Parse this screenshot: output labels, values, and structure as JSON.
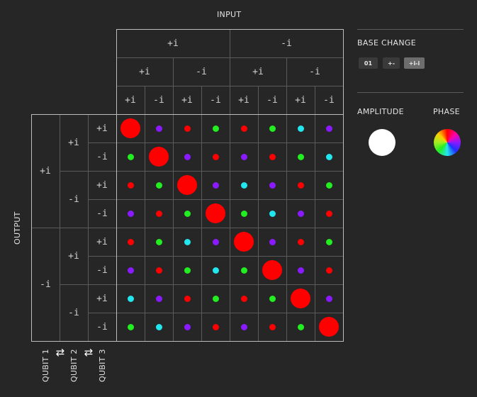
{
  "input_label": "INPUT",
  "output_label": "OUTPUT",
  "col_headers": {
    "q1": [
      "+i",
      "-i"
    ],
    "q2": [
      "+i",
      "-i",
      "+i",
      "-i"
    ],
    "q3": [
      "+i",
      "-i",
      "+i",
      "-i",
      "+i",
      "-i",
      "+i",
      "-i"
    ]
  },
  "row_headers": {
    "q1": [
      "+i",
      "-i"
    ],
    "q2": [
      "+i",
      "-i",
      "+i",
      "-i"
    ],
    "q3": [
      "+i",
      "-i",
      "+i",
      "-i",
      "+i",
      "-i",
      "+i",
      "-i"
    ]
  },
  "qubits": [
    "QUBIT 1",
    "QUBIT 2",
    "QUBIT 3"
  ],
  "swap_icon": "swap-arrows-icon",
  "base_change": {
    "title": "BASE CHANGE",
    "buttons": [
      {
        "label": "01",
        "active": false
      },
      {
        "label": "+-",
        "active": false
      },
      {
        "label": "+i-i",
        "active": true
      }
    ]
  },
  "amplitude": {
    "title": "AMPLITUDE"
  },
  "phase": {
    "title": "PHASE"
  },
  "colors": {
    "red": "#ff0000",
    "green": "#22ee22",
    "cyan": "#22e6ee",
    "purple": "#8a1aff",
    "background": "#262626",
    "grid": "#5a5a5a",
    "border": "#bdbdbd"
  },
  "matrix": [
    [
      "R",
      "P",
      "R",
      "G",
      "R",
      "G",
      "C",
      "P"
    ],
    [
      "G",
      "R",
      "P",
      "R",
      "P",
      "R",
      "G",
      "C"
    ],
    [
      "R",
      "G",
      "R",
      "P",
      "C",
      "P",
      "R",
      "G"
    ],
    [
      "P",
      "R",
      "G",
      "R",
      "G",
      "C",
      "P",
      "R"
    ],
    [
      "R",
      "G",
      "C",
      "P",
      "R",
      "P",
      "R",
      "G"
    ],
    [
      "P",
      "R",
      "G",
      "C",
      "G",
      "R",
      "P",
      "R"
    ],
    [
      "C",
      "P",
      "R",
      "G",
      "R",
      "G",
      "R",
      "P"
    ],
    [
      "G",
      "C",
      "P",
      "R",
      "P",
      "R",
      "G",
      "R"
    ]
  ],
  "diagonal_amplitude": 1.0,
  "offdiagonal_amplitude": 0.35
}
